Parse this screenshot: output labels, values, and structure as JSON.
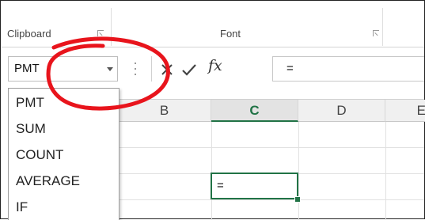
{
  "ribbon": {
    "groups": [
      {
        "label": "Clipboard",
        "launcher": "dialog-launcher-icon"
      },
      {
        "label": "Font",
        "launcher": "dialog-launcher-icon"
      }
    ]
  },
  "formula_bar": {
    "name_box_value": "PMT",
    "cancel_icon": "x-cancel-icon",
    "enter_icon": "checkmark-enter-icon",
    "fx_label": "fx",
    "formula_value": "="
  },
  "function_dropdown": {
    "items": [
      "PMT",
      "SUM",
      "COUNT",
      "AVERAGE",
      "IF"
    ]
  },
  "sheet": {
    "column_headers": [
      "B",
      "C",
      "D",
      "E"
    ],
    "selected_column": "C",
    "active_cell_value": "="
  },
  "colors": {
    "accent_green": "#217346",
    "annotation_red": "#e8141c"
  }
}
